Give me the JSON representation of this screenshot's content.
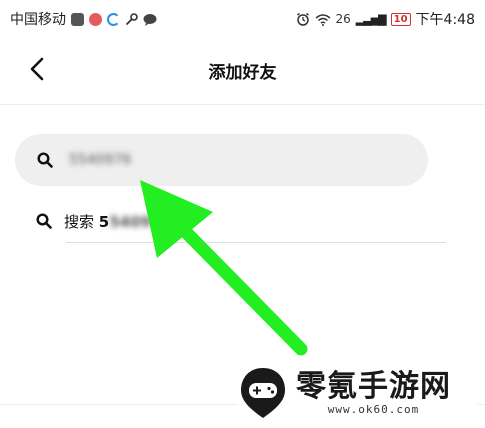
{
  "status_bar": {
    "carrier": "中国移动",
    "network": "26",
    "battery": "10",
    "time": "下午4:48"
  },
  "header": {
    "back_icon": "chevron-left-icon",
    "title": "添加好友"
  },
  "search": {
    "value": "5540976",
    "icon": "search-icon"
  },
  "suggestion": {
    "prefix": "搜索",
    "query_visible": "5",
    "query_blurred": "540976",
    "icon": "search-icon"
  },
  "annotation": {
    "arrow_color": "#22ee22"
  },
  "watermark": {
    "brand": "零氪手游网",
    "url": "www.ok60.com"
  }
}
